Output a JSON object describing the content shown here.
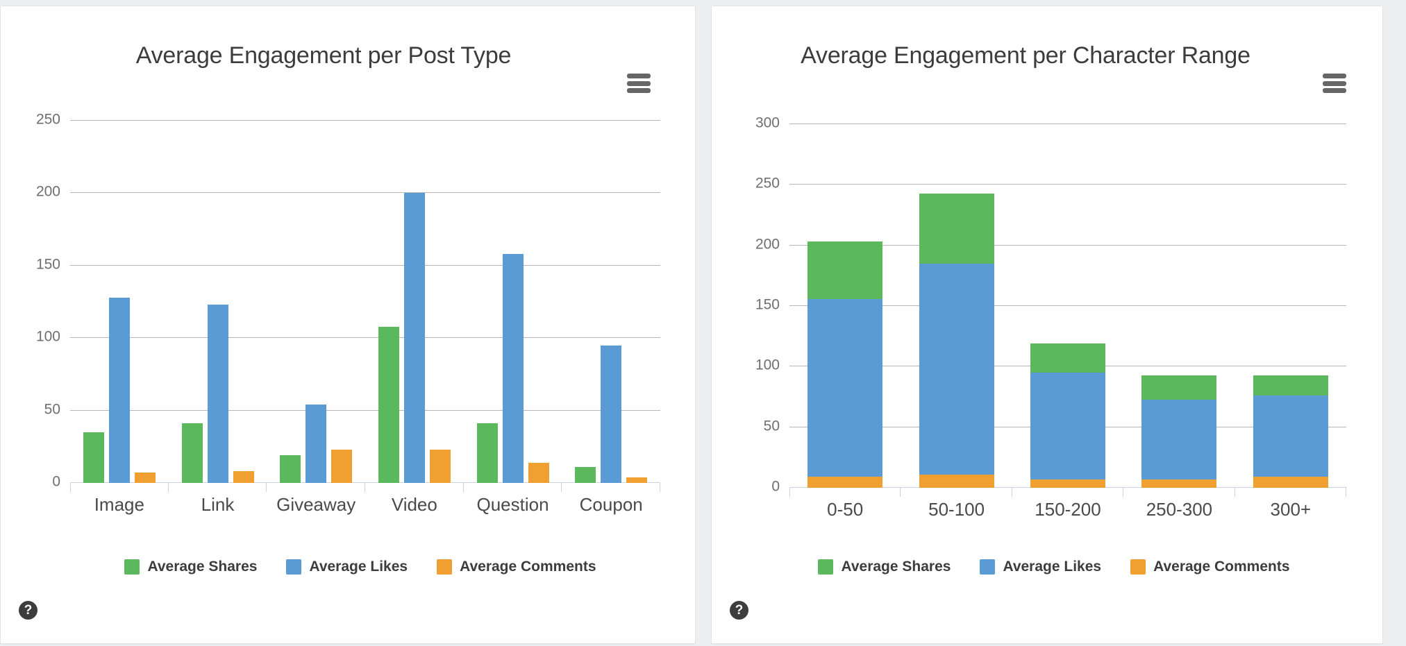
{
  "page": {
    "background": "#eceeef"
  },
  "palette": {
    "shares_green": "#5CB85C",
    "likes_blue": "#5B9BD5",
    "comments_orange": "#F0A030",
    "gridline": "#b6b6b6",
    "axis": "#c7d3de",
    "title_text": "#3c3c3c",
    "tick_text": "#6e6e6e"
  },
  "panels": [
    {
      "id": "post-type",
      "title": "Average Engagement per Post Type",
      "menu_icon": "hamburger-menu-icon",
      "help_icon": "help-question-icon",
      "help_label": "?"
    },
    {
      "id": "character-range",
      "title": "Average Engagement per Character Range",
      "menu_icon": "hamburger-menu-icon",
      "help_icon": "help-question-icon",
      "help_label": "?"
    }
  ],
  "legend": {
    "items": [
      {
        "label": "Average Shares",
        "color": "#5CB85C"
      },
      {
        "label": "Average Likes",
        "color": "#5B9BD5"
      },
      {
        "label": "Average Comments",
        "color": "#F0A030"
      }
    ]
  },
  "chart_data": [
    {
      "id": "post-type",
      "type": "bar",
      "stacked": false,
      "title": "Average Engagement per Post Type",
      "xlabel": "",
      "ylabel": "",
      "ylim": [
        0,
        250
      ],
      "yticks": [
        0,
        50,
        100,
        150,
        200,
        250
      ],
      "grid": true,
      "legend_position": "bottom",
      "categories": [
        "Image",
        "Link",
        "Giveaway",
        "Video",
        "Question",
        "Coupon"
      ],
      "series": [
        {
          "name": "Average Shares",
          "color": "#5CB85C",
          "values": [
            35,
            41,
            19,
            108,
            41,
            11
          ]
        },
        {
          "name": "Average Likes",
          "color": "#5B9BD5",
          "values": [
            128,
            123,
            54,
            200,
            158,
            95
          ]
        },
        {
          "name": "Average Comments",
          "color": "#F0A030",
          "values": [
            7,
            8,
            23,
            23,
            14,
            4
          ]
        }
      ]
    },
    {
      "id": "character-range",
      "type": "bar",
      "stacked": true,
      "title": "Average Engagement per Character Range",
      "xlabel": "",
      "ylabel": "",
      "ylim": [
        0,
        300
      ],
      "yticks": [
        0,
        50,
        100,
        150,
        200,
        250,
        300
      ],
      "grid": true,
      "legend_position": "bottom",
      "categories": [
        "0-50",
        "50-100",
        "150-200",
        "250-300",
        "300+"
      ],
      "series": [
        {
          "name": "Average Comments",
          "color": "#F0A030",
          "values": [
            9,
            11,
            7,
            7,
            9
          ]
        },
        {
          "name": "Average Likes",
          "color": "#5B9BD5",
          "values": [
            147,
            174,
            88,
            66,
            67
          ]
        },
        {
          "name": "Average Shares",
          "color": "#5CB85C",
          "values": [
            47,
            58,
            24,
            20,
            17
          ]
        }
      ],
      "totals": [
        203,
        243,
        119,
        93,
        93
      ]
    }
  ]
}
